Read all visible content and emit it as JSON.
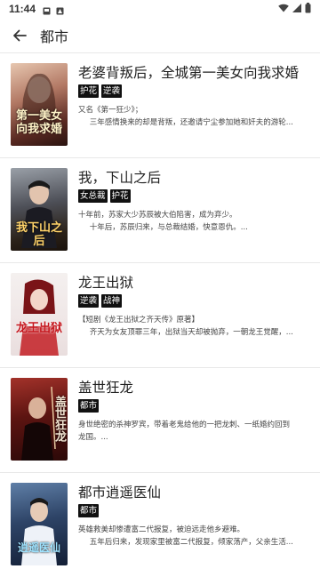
{
  "status_bar": {
    "time": "11:44"
  },
  "toolbar": {
    "title": "都市"
  },
  "books": [
    {
      "title": "老婆背叛后，全城第一美女向我求婚",
      "tags": [
        "护花",
        "逆袭"
      ],
      "desc_lines": [
        "又名《第一狂少》；",
        "三年感情换来的却是背叛，还邀请宁尘参加她和奸夫的游轮..."
      ],
      "cover_text": "第一美女向我求婚"
    },
    {
      "title": "我，下山之后",
      "tags": [
        "女总裁",
        "护花"
      ],
      "desc_lines": [
        "十年前，苏家大少苏辰被大伯陷害，成为弃少。",
        "十年后，苏辰归来，与总裁结婚，快意恩仇。..."
      ],
      "cover_text": "我下山之后"
    },
    {
      "title": "龙王出狱",
      "tags": [
        "逆袭",
        "战神"
      ],
      "desc_lines": [
        "【短剧《龙王出狱之齐天传》原著】",
        "齐天为女友顶罪三年，出狱当天却被抛弃，一朝龙王觉醒，..."
      ],
      "cover_text": "龙王出狱"
    },
    {
      "title": "盖世狂龙",
      "tags": [
        "都市"
      ],
      "desc_lines": [
        "身世绝密的杀神罗宾，带着老鬼给他的一把龙刺、一纸婚约回到",
        "龙国。..."
      ],
      "cover_text": "盖世狂龙"
    },
    {
      "title": "都市逍遥医仙",
      "tags": [
        "都市"
      ],
      "desc_lines": [
        "英雄救美却惨遭富二代报复，被迫远走他乡避难。",
        "五年后归来，发现家里被富二代报复，倾家荡产，父亲生活..."
      ],
      "cover_text": "逍遥医仙"
    }
  ]
}
